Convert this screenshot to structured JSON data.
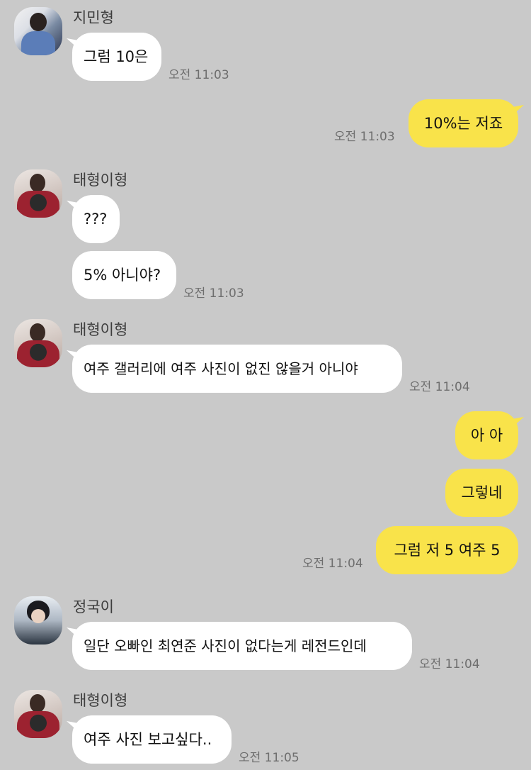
{
  "messages": {
    "m1": {
      "sender": "지민형",
      "text": "그럼 10은",
      "time": "오전 11:03"
    },
    "m2": {
      "text": "10%는 저죠",
      "time": "오전 11:03"
    },
    "m3": {
      "sender": "태형이형",
      "text": "???"
    },
    "m4": {
      "text": "5% 아니야?",
      "time": "오전 11:03"
    },
    "m5": {
      "sender": "태형이형",
      "text": "여주 갤러리에 여주 사진이 없진 않을거 아니야",
      "time": "오전 11:04"
    },
    "m6": {
      "text": "아 아"
    },
    "m7": {
      "text": "그렇네"
    },
    "m8": {
      "text": "그럼 저 5 여주 5",
      "time": "오전 11:04"
    },
    "m9": {
      "sender": "정국이",
      "text": "일단 오빠인 최연준 사진이 없다는게 레전드인데",
      "time": "오전 11:04"
    },
    "m10": {
      "sender": "태형이형",
      "text": "여주 사진 보고싶다..",
      "time": "오전 11:05"
    }
  },
  "avatars": {
    "jimin": "avatar-jimin",
    "taehyung": "avatar-taehyung",
    "jungkook": "avatar-jungkook"
  },
  "colors": {
    "background": "#c9c9c9",
    "incoming_bubble": "#ffffff",
    "outgoing_bubble": "#f9e34a"
  }
}
